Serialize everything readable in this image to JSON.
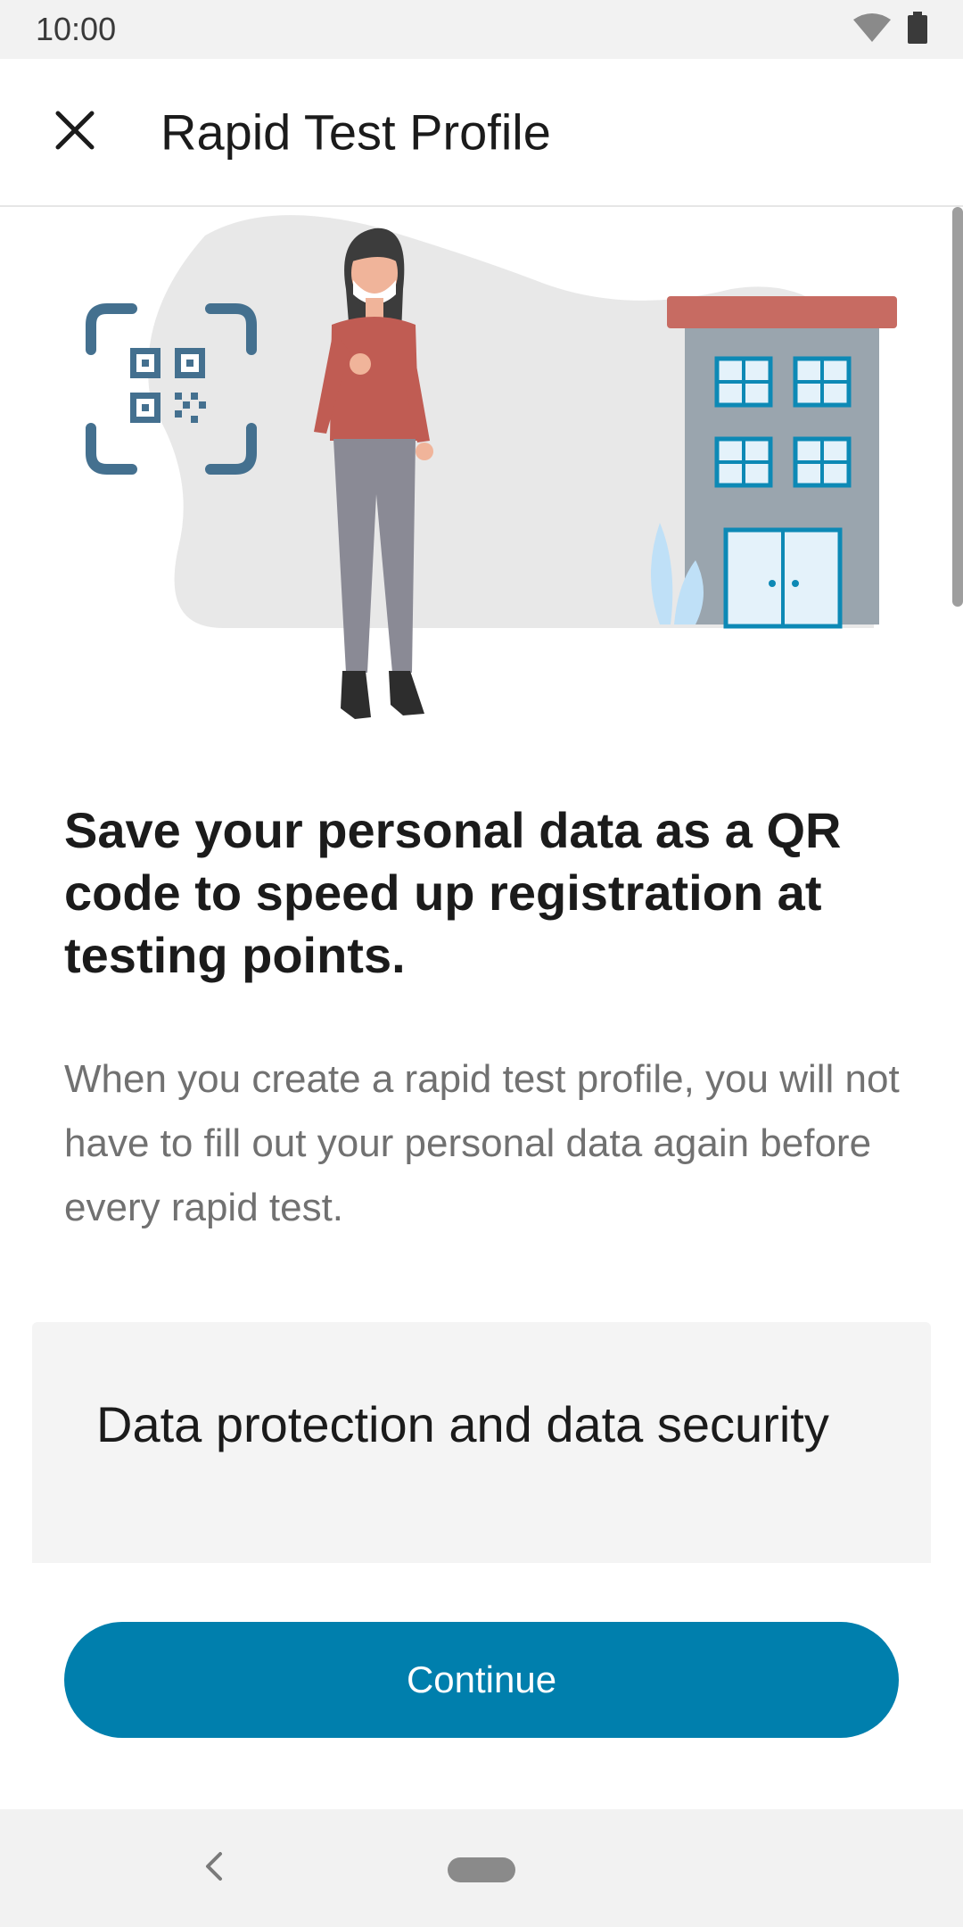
{
  "status_bar": {
    "time": "10:00",
    "icons": [
      "wifi-icon",
      "battery-icon"
    ]
  },
  "app_bar": {
    "close_icon": "close-icon",
    "title": "Rapid Test Profile"
  },
  "main": {
    "headline": "Save your personal data as a QR code to speed up registration at testing points.",
    "body": "When you create a rapid test profile, you will not have to fill out your personal data again before every rapid test.",
    "privacy_card": {
      "title": "Data protection and data security"
    },
    "continue_label": "Continue"
  },
  "navigation": {
    "back_icon": "back-chevron-icon",
    "home_icon": "home-pill-icon"
  },
  "colors": {
    "primary": "#007fad",
    "qr_frame": "#44708f",
    "building_roof": "#c76b62",
    "building_body": "#9aa5ae",
    "window": "#0d89b5",
    "shirt": "#c05c53",
    "pants": "#8a8a95",
    "hair": "#3c3c3c",
    "skin": "#f0b49a",
    "blob": "#e8e8e8",
    "plant": "#bfe0f7"
  }
}
